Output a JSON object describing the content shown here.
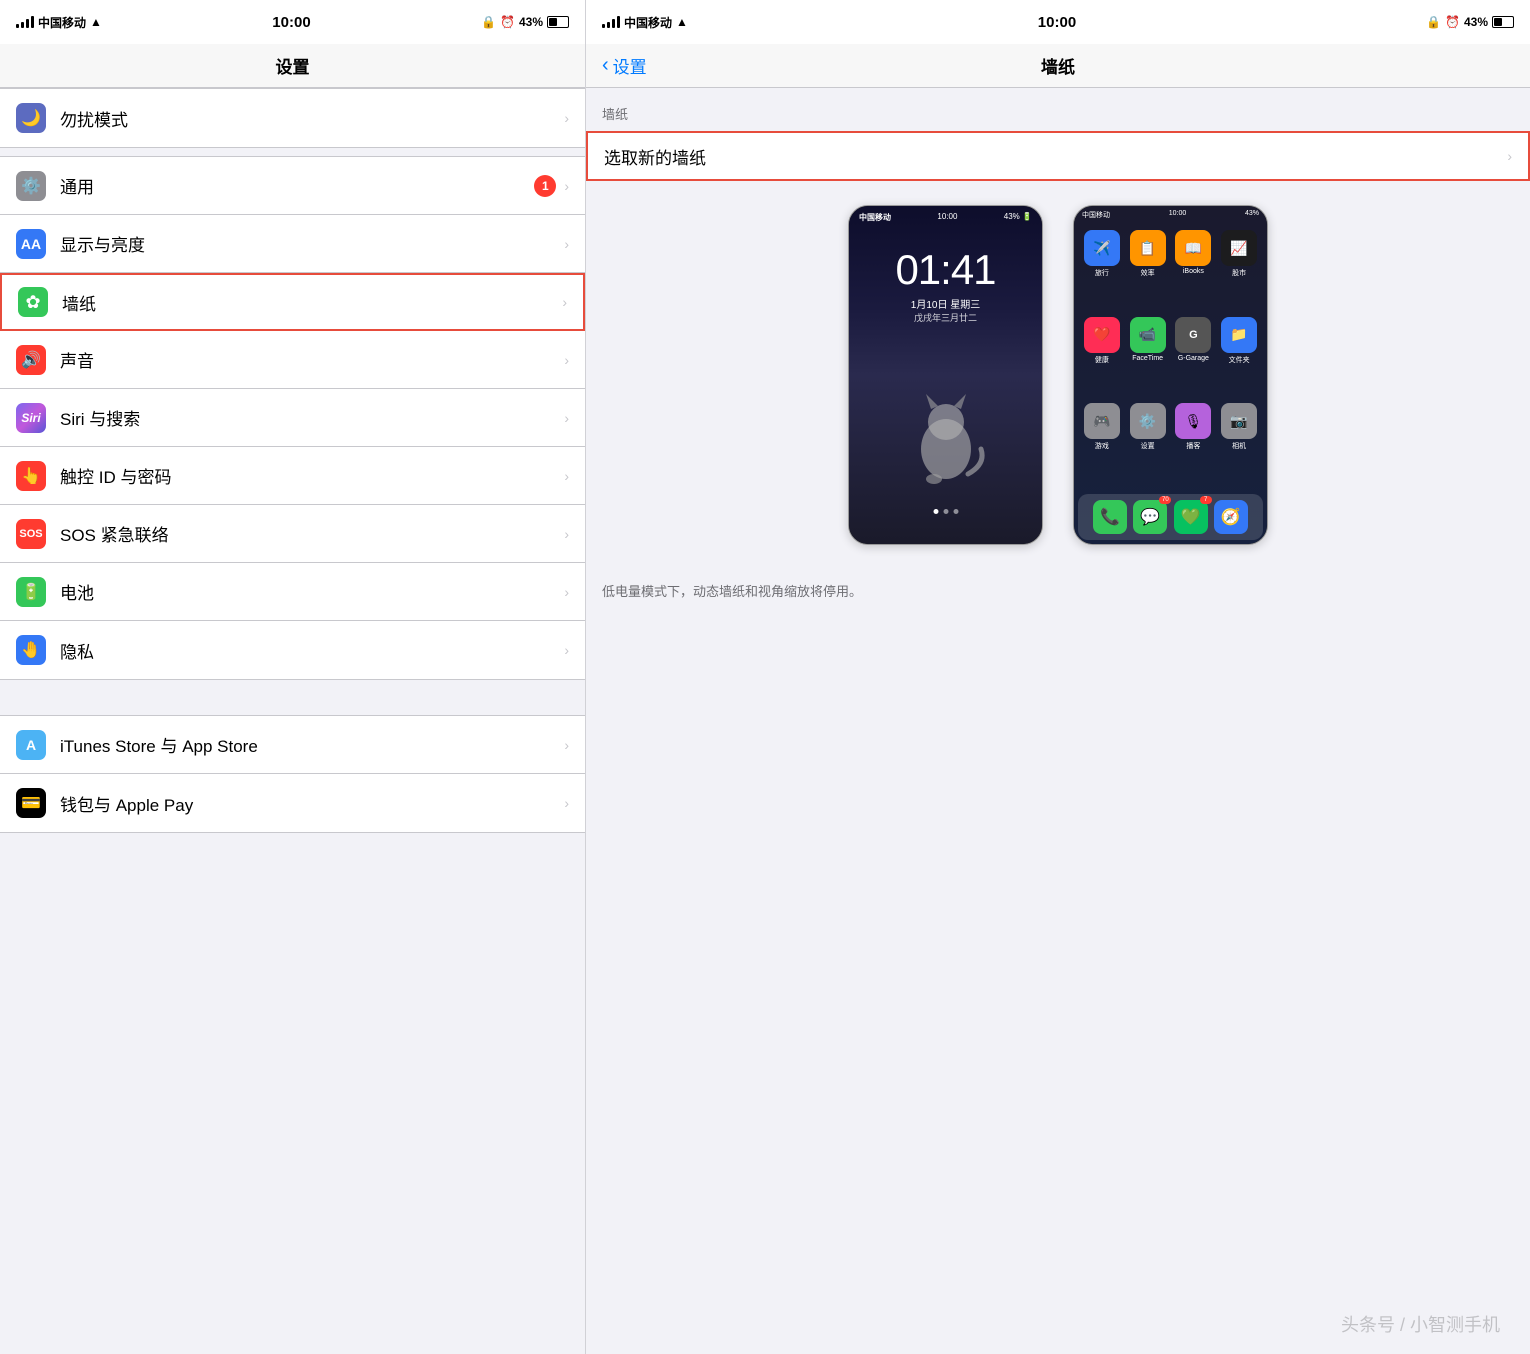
{
  "left": {
    "statusBar": {
      "carrier": "中国移动",
      "wifi": "WiFi",
      "time": "10:00",
      "lock": "🔒",
      "alarm": "⏰",
      "battery": "43%"
    },
    "navTitle": "设置",
    "items": [
      {
        "id": "dnd",
        "label": "勿扰模式",
        "iconClass": "icon-dnd",
        "iconType": "moon",
        "badge": null,
        "highlighted": false
      },
      {
        "id": "general",
        "label": "通用",
        "iconClass": "icon-general",
        "iconType": "gear",
        "badge": "1",
        "highlighted": false
      },
      {
        "id": "display",
        "label": "显示与亮度",
        "iconClass": "icon-display",
        "iconType": "aa",
        "badge": null,
        "highlighted": false
      },
      {
        "id": "wallpaper",
        "label": "墙纸",
        "iconClass": "icon-wallpaper",
        "iconType": "flower",
        "badge": null,
        "highlighted": true
      },
      {
        "id": "sound",
        "label": "声音",
        "iconClass": "icon-sound",
        "iconType": "sound",
        "badge": null,
        "highlighted": false
      },
      {
        "id": "siri",
        "label": "Siri 与搜索",
        "iconClass": "icon-siri",
        "iconType": "siri",
        "badge": null,
        "highlighted": false
      },
      {
        "id": "touch",
        "label": "触控 ID 与密码",
        "iconClass": "icon-touch",
        "iconType": "touch",
        "badge": null,
        "highlighted": false
      },
      {
        "id": "sos",
        "label": "SOS 紧急联络",
        "iconClass": "icon-sos",
        "iconType": "sos",
        "badge": null,
        "highlighted": false
      },
      {
        "id": "battery",
        "label": "电池",
        "iconClass": "icon-battery",
        "iconType": "battery",
        "badge": null,
        "highlighted": false
      },
      {
        "id": "privacy",
        "label": "隐私",
        "iconClass": "icon-privacy",
        "iconType": "hand",
        "badge": null,
        "highlighted": false
      }
    ],
    "bottomItems": [
      {
        "id": "itunes",
        "label": "iTunes Store 与 App Store",
        "iconClass": "icon-itunes",
        "iconType": "itunes",
        "badge": null
      },
      {
        "id": "wallet",
        "label": "钱包与 Apple Pay",
        "iconClass": "icon-wallet",
        "iconType": "wallet",
        "badge": null
      }
    ]
  },
  "right": {
    "statusBar": {
      "carrier": "中国移动",
      "wifi": "WiFi",
      "time": "10:00",
      "lock": "🔒",
      "alarm": "⏰",
      "battery": "43%"
    },
    "backLabel": "设置",
    "navTitle": "墙纸",
    "sectionLabel": "墙纸",
    "selectLabel": "选取新的墙纸",
    "lockscreen": {
      "time": "01:41",
      "date": "1月10日 星期三",
      "subdate": "戊戌年三月廿二"
    },
    "note": "低电量模式下，动态墙纸和视角缩放将停用。",
    "watermark": "头条号 / 小智测手机",
    "appGrid": [
      {
        "label": "旅行",
        "color": "#3478f6",
        "char": "✈"
      },
      {
        "label": "效率",
        "color": "#ff9500",
        "char": "📋"
      },
      {
        "label": "iBooks",
        "color": "#ff9500",
        "char": "📖"
      },
      {
        "label": "股市",
        "color": "#000",
        "char": "📈"
      },
      {
        "label": "健康",
        "color": "#ff2d55",
        "char": "❤"
      },
      {
        "label": "FaceTime",
        "color": "#34c759",
        "char": "📹"
      },
      {
        "label": "G-Garage",
        "color": "#555",
        "char": "G"
      },
      {
        "label": "文件夹",
        "color": "#3478f6",
        "char": "📁"
      },
      {
        "label": "游戏",
        "color": "#8e8e93",
        "char": "🎮"
      },
      {
        "label": "设置",
        "color": "#8e8e93",
        "char": "⚙"
      },
      {
        "label": "播客",
        "color": "#b562dc",
        "char": "🎙"
      },
      {
        "label": "相机",
        "color": "#8e8e93",
        "char": "📷"
      }
    ],
    "dockApps": [
      {
        "label": "电话",
        "color": "#34c759",
        "char": "📞",
        "badge": null
      },
      {
        "label": "短信",
        "color": "#34c759",
        "char": "💬",
        "badge": "70"
      },
      {
        "label": "微信",
        "color": "#07c160",
        "char": "💚",
        "badge": "7"
      },
      {
        "label": "Safari",
        "color": "#3478f6",
        "char": "🧭",
        "badge": null
      }
    ]
  }
}
